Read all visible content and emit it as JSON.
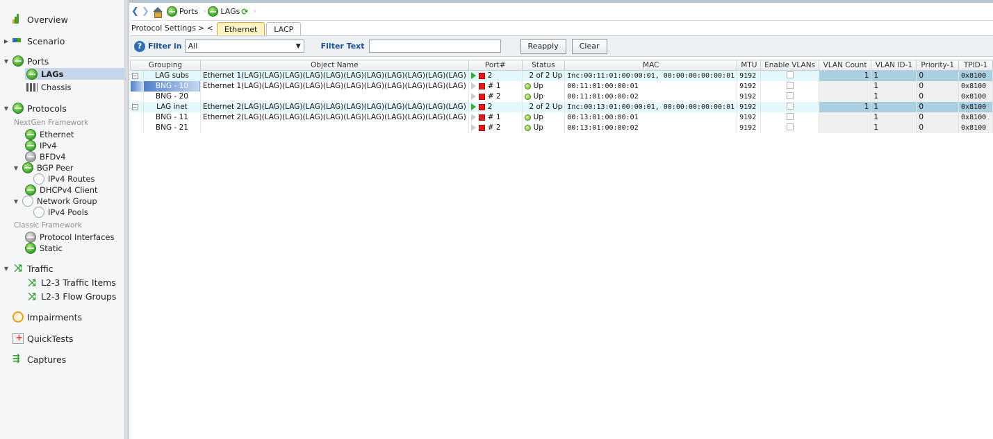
{
  "sidebar": {
    "overview": "Overview",
    "scenario": "Scenario",
    "ports": "Ports",
    "lags": "LAGs",
    "chassis": "Chassis",
    "protocols": "Protocols",
    "nextgen_section": "NextGen Framework",
    "ethernet": "Ethernet",
    "ipv4": "IPv4",
    "bfdv4": "BFDv4",
    "bgp_peer": "BGP Peer",
    "ipv4_routes": "IPv4 Routes",
    "dhcpv4_client": "DHCPv4 Client",
    "network_group": "Network Group",
    "ipv4_pools": "IPv4 Pools",
    "classic_section": "Classic Framework",
    "protocol_interfaces": "Protocol Interfaces",
    "static": "Static",
    "traffic": "Traffic",
    "l23_traffic_items": "L2-3 Traffic Items",
    "l23_flow_groups": "L2-3 Flow Groups",
    "impairments": "Impairments",
    "quicktests": "QuickTests",
    "captures": "Captures"
  },
  "breadcrumb": {
    "ports": "Ports",
    "lags": "LAGs"
  },
  "tabs": {
    "protocol_settings": "Protocol Settings",
    "ethernet": "Ethernet",
    "lacp": "LACP"
  },
  "filter": {
    "filter_in_label": "Filter in",
    "filter_in_value": "All",
    "filter_text_label": "Filter Text",
    "filter_text_value": "",
    "reapply": "Reapply",
    "clear": "Clear"
  },
  "grid": {
    "headers": [
      "Grouping",
      "Object Name",
      "Port#",
      "Status",
      "MAC",
      "MTU",
      "Enable VLANs",
      "VLAN Count",
      "VLAN ID-1",
      "Priority-1",
      "TPID-1"
    ],
    "rows": [
      {
        "grouping": "LAG subs",
        "object": "Ethernet 1(LAG)(LAG)(LAG)(LAG)(LAG)(LAG)(LAG)(LAG)(LAG)(LAG)(LAG)",
        "port": "2",
        "status": "2 of 2 Up",
        "mac": "Inc:00:11:01:00:00:01, 00:00:00:00:00:01",
        "mtu": "9192",
        "vlan_count": "1",
        "vlan_id": "1",
        "priority": "0",
        "tpid": "0x8100"
      },
      {
        "grouping": "BNG - 10",
        "object": "Ethernet 1(LAG)(LAG)(LAG)(LAG)(LAG)(LAG)(LAG)(LAG)(LAG)(LAG)(LAG)",
        "port": "# 1",
        "status": "Up",
        "mac": "00:11:01:00:00:01",
        "mtu": "9192",
        "vlan_count": "",
        "vlan_id": "1",
        "priority": "0",
        "tpid": "0x8100"
      },
      {
        "grouping": "BNG - 20",
        "object": "",
        "port": "# 2",
        "status": "Up",
        "mac": "00:11:01:00:00:02",
        "mtu": "9192",
        "vlan_count": "",
        "vlan_id": "1",
        "priority": "0",
        "tpid": "0x8100"
      },
      {
        "grouping": "LAG inet",
        "object": "Ethernet 2(LAG)(LAG)(LAG)(LAG)(LAG)(LAG)(LAG)(LAG)(LAG)(LAG)(LAG)",
        "port": "2",
        "status": "2 of 2 Up",
        "mac": "Inc:00:13:01:00:00:01, 00:00:00:00:00:01",
        "mtu": "9192",
        "vlan_count": "1",
        "vlan_id": "1",
        "priority": "0",
        "tpid": "0x8100"
      },
      {
        "grouping": "BNG - 11",
        "object": "Ethernet 2(LAG)(LAG)(LAG)(LAG)(LAG)(LAG)(LAG)(LAG)(LAG)(LAG)(LAG)",
        "port": "# 1",
        "status": "Up",
        "mac": "00:13:01:00:00:01",
        "mtu": "9192",
        "vlan_count": "",
        "vlan_id": "1",
        "priority": "0",
        "tpid": "0x8100"
      },
      {
        "grouping": "BNG - 21",
        "object": "",
        "port": "# 2",
        "status": "Up",
        "mac": "00:13:01:00:00:02",
        "mtu": "9192",
        "vlan_count": "",
        "vlan_id": "1",
        "priority": "0",
        "tpid": "0x8100"
      }
    ]
  }
}
